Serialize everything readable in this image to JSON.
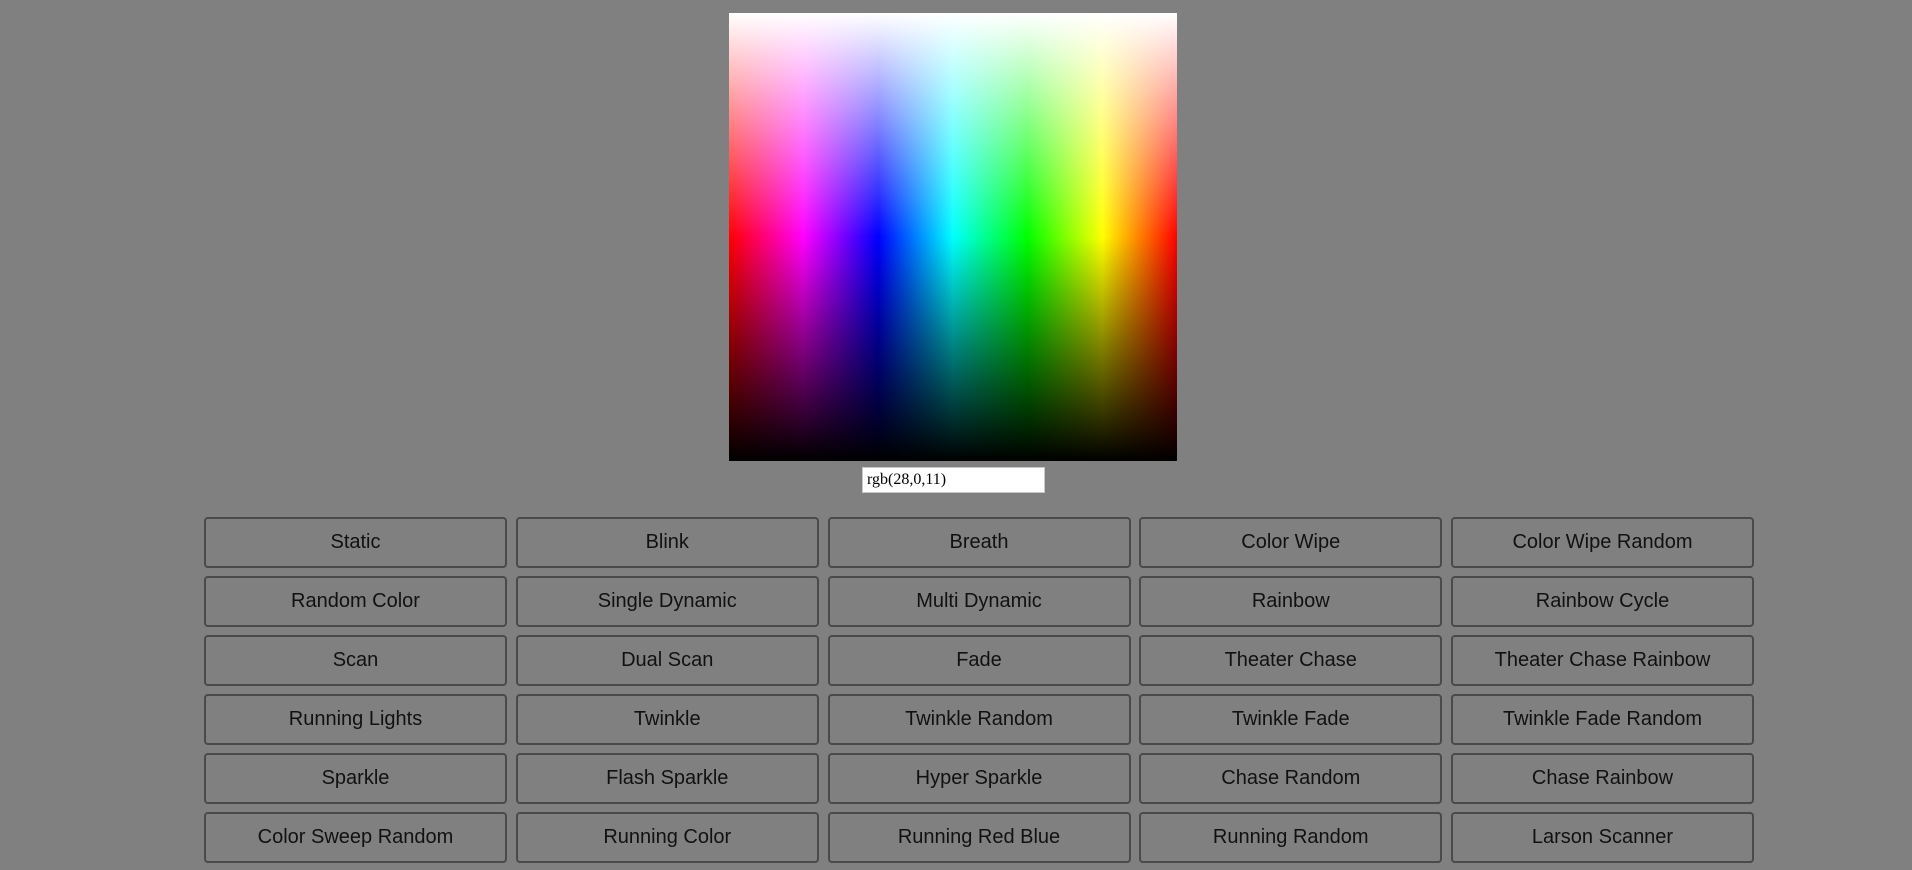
{
  "color_input": {
    "value": "rgb(28,0,11)"
  },
  "modes": [
    "Static",
    "Blink",
    "Breath",
    "Color Wipe",
    "Color Wipe Random",
    "Random Color",
    "Single Dynamic",
    "Multi Dynamic",
    "Rainbow",
    "Rainbow Cycle",
    "Scan",
    "Dual Scan",
    "Fade",
    "Theater Chase",
    "Theater Chase Rainbow",
    "Running Lights",
    "Twinkle",
    "Twinkle Random",
    "Twinkle Fade",
    "Twinkle Fade Random",
    "Sparkle",
    "Flash Sparkle",
    "Hyper Sparkle",
    "Chase Random",
    "Chase Rainbow",
    "Color Sweep Random",
    "Running Color",
    "Running Red Blue",
    "Running Random",
    "Larson Scanner"
  ]
}
